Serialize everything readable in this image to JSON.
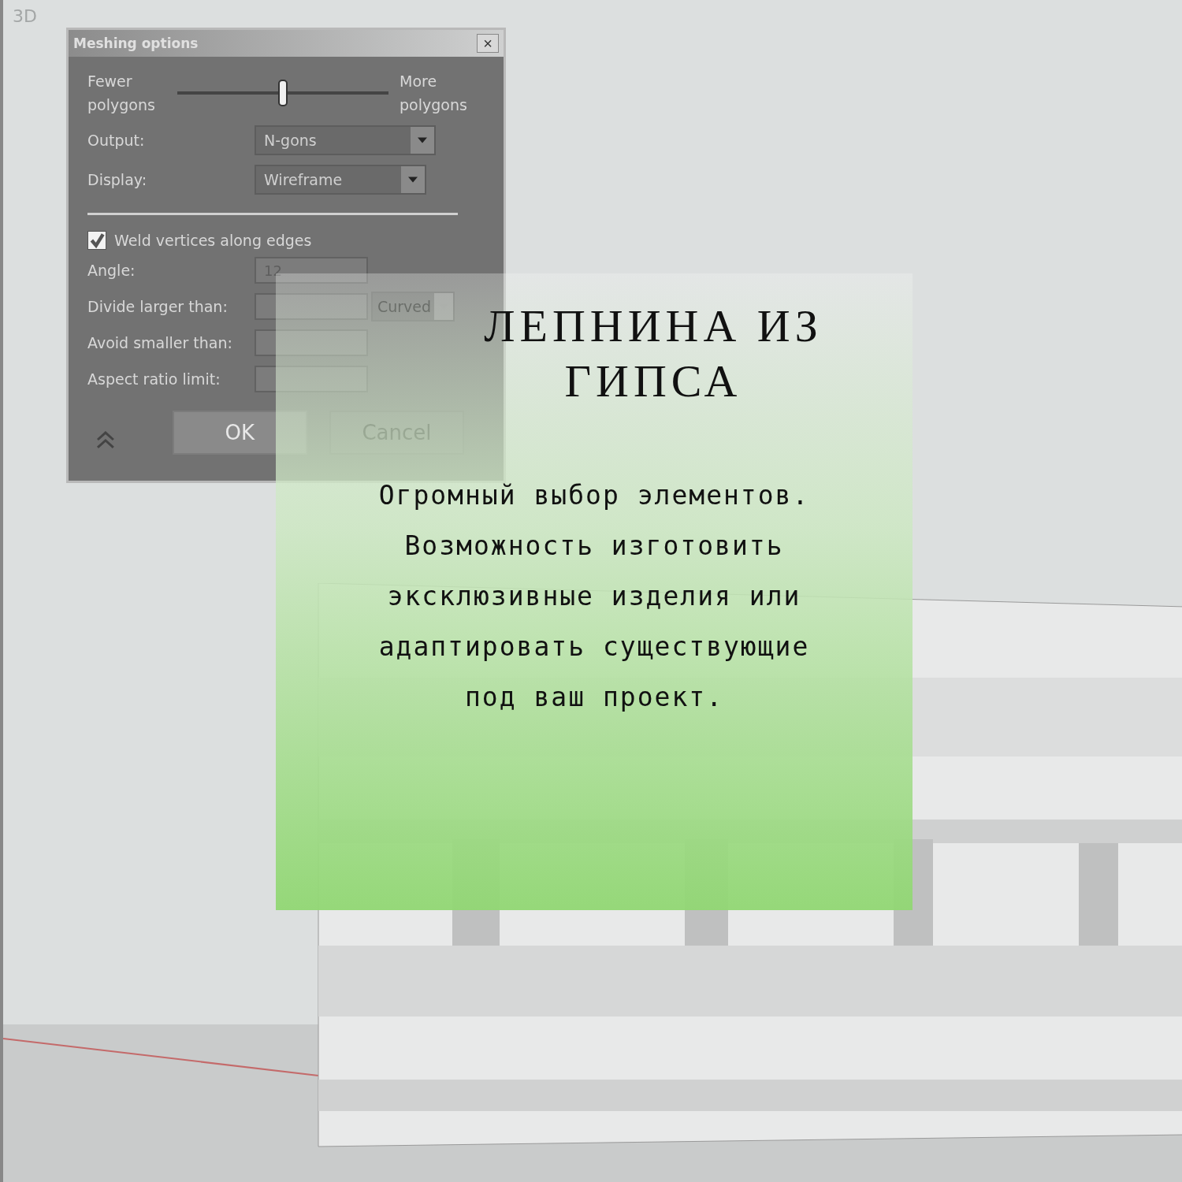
{
  "viewport": {
    "label": "3D"
  },
  "dialog": {
    "title": "Meshing options",
    "close": "×",
    "slider": {
      "left_label": "Fewer polygons",
      "right_label": "More polygons",
      "level": 0.5
    },
    "dropdowns": [
      {
        "label": "Output:",
        "value": "N-gons"
      },
      {
        "label": "Display:",
        "value": "Wireframe"
      }
    ],
    "weld": {
      "label": "Weld vertices along edges",
      "checked": true
    },
    "fields": [
      {
        "label": "Angle:",
        "value": "12",
        "disabled": true
      },
      {
        "label": "Divide larger than:",
        "disabled": true,
        "unit": "Curved"
      },
      {
        "label": "Avoid smaller than:",
        "disabled": true
      },
      {
        "label": "Aspect ratio limit:",
        "disabled": true
      }
    ],
    "buttons": [
      {
        "label": "OK",
        "disabled": false
      },
      {
        "label": "Cancel",
        "disabled": true
      }
    ]
  },
  "card": {
    "title": "ЛЕПНИНА ИЗ ГИПСА",
    "text": "Огромный выбор элементов. Возможность изготовить эксклюзивные изделия или адаптировать существующие под ваш проект."
  }
}
